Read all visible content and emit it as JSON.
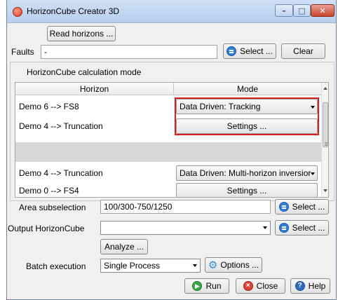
{
  "window": {
    "title": "HorizonCube Creator 3D",
    "controls": {
      "minimize": "–",
      "maximize": "□",
      "close": "✕"
    }
  },
  "read_horizons_label": "Read horizons ...",
  "faults": {
    "label": "Faults",
    "value": "-",
    "select_label": "Select ...",
    "clear_label": "Clear"
  },
  "calc_mode": {
    "group_label": "HorizonCube calculation mode",
    "columns": [
      "Horizon",
      "Mode"
    ],
    "rows": [
      {
        "horizon": "Demo 6 --> FS8",
        "mode": "Data Driven: Tracking",
        "kind": "dropdown",
        "highlight": true
      },
      {
        "horizon": "Demo 4 --> Truncation",
        "mode": "Settings ...",
        "kind": "button",
        "highlight": true
      },
      {
        "horizon": "Demo 4 --> Truncation",
        "mode": "Data Driven: Multi-horizon inversior",
        "kind": "dropdown",
        "highlight": false
      },
      {
        "horizon": "Demo 0 --> FS4",
        "mode": "Settings ...",
        "kind": "button",
        "highlight": false
      }
    ]
  },
  "area": {
    "label": "Area subselection",
    "value": "100/300-750/1250",
    "select_label": "Select ..."
  },
  "output": {
    "label": "Output HorizonCube",
    "value": "",
    "select_label": "Select ..."
  },
  "analyze_label": "Analyze ...",
  "batch": {
    "label": "Batch execution",
    "value": "Single Process",
    "options_label": "Options ..."
  },
  "footer": {
    "run_label": "Run",
    "close_label": "Close",
    "help_label": "Help"
  },
  "colors": {
    "highlight_border": "#d92020",
    "select_icon": "#2f7fd6",
    "run_icon": "#3aa844",
    "close_icon": "#d64535",
    "help_icon": "#2f6cc2"
  }
}
